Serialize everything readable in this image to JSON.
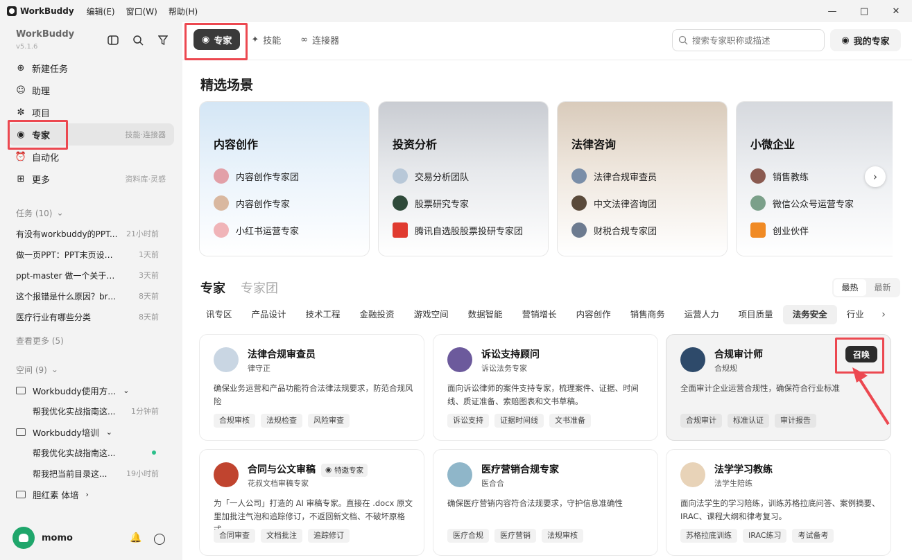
{
  "titlebar": {
    "app": "WorkBuddy",
    "menus": [
      "编辑(E)",
      "窗口(W)",
      "帮助(H)"
    ]
  },
  "sidebar": {
    "brand": "WorkBuddy",
    "version": "v5.1.6",
    "nav": [
      {
        "label": "新建任务",
        "hint": ""
      },
      {
        "label": "助理",
        "hint": ""
      },
      {
        "label": "项目",
        "hint": ""
      },
      {
        "label": "专家",
        "hint": "技能·连接器"
      },
      {
        "label": "自动化",
        "hint": ""
      },
      {
        "label": "更多",
        "hint": "资料库·灵感"
      }
    ],
    "tasks_title": "任务 (10)",
    "tasks": [
      {
        "title": "有没有workbuddy的PPT...",
        "time": "21小时前"
      },
      {
        "title": "做一页PPT：PPT末页设计...",
        "time": "1天前"
      },
      {
        "title": "ppt-master 做一个关于中...",
        "time": "3天前"
      },
      {
        "title": "这个报错是什么原因？bro...",
        "time": "8天前"
      },
      {
        "title": "医疗行业有哪些分类",
        "time": "8天前"
      }
    ],
    "see_more": "查看更多 (5)",
    "spaces_title": "空间 (9)",
    "spaces": [
      {
        "name": "Workbuddy使用方...",
        "children": [
          {
            "title": "帮我优化实战指南这...",
            "time": "1分钟前"
          }
        ]
      },
      {
        "name": "Workbuddy培训",
        "children": [
          {
            "title": "帮我优化实战指南这...",
            "time": ""
          },
          {
            "title": "帮我把当前目录这...",
            "time": "19小时前"
          }
        ]
      },
      {
        "name": "胆红素 体培",
        "children": []
      }
    ],
    "user": "momo"
  },
  "main": {
    "tabs": [
      "专家",
      "技能",
      "连接器"
    ],
    "search_placeholder": "搜索专家职称或描述",
    "my_experts": "我的专家",
    "featured_title": "精选场景",
    "featured": [
      {
        "title": "内容创作",
        "items": [
          "内容创作专家团",
          "内容创作专家",
          "小红书运营专家"
        ]
      },
      {
        "title": "投资分析",
        "items": [
          "交易分析团队",
          "股票研究专家",
          "腾讯自选股股票投研专家团"
        ]
      },
      {
        "title": "法律咨询",
        "items": [
          "法律合规审查员",
          "中文法律咨询团",
          "财税合规专家团"
        ]
      },
      {
        "title": "小微企业",
        "items": [
          "销售教练",
          "微信公众号运营专家",
          "创业伙伴"
        ]
      }
    ],
    "section_tabs": [
      "专家",
      "专家团"
    ],
    "sort": [
      "最热",
      "最新"
    ],
    "categories": [
      "讯专区",
      "产品设计",
      "技术工程",
      "金融投资",
      "游戏空间",
      "数据智能",
      "营销增长",
      "内容创作",
      "销售商务",
      "运营人力",
      "项目质量",
      "法务安全",
      "行业"
    ],
    "active_category": "法务安全",
    "cards": [
      {
        "name": "法律合规审查员",
        "sub": "律守正",
        "badge": "",
        "desc": "确保业务运营和产品功能符合法律法规要求，防范合规风险",
        "tags": [
          "合规审核",
          "法规检查",
          "风险审查"
        ]
      },
      {
        "name": "诉讼支持顾问",
        "sub": "诉讼法务专家",
        "badge": "",
        "desc": "面向诉讼律师的案件支持专家，梳理案件、证据、时间线、质证准备、索赔图表和文书草稿。",
        "tags": [
          "诉讼支持",
          "证据时间线",
          "文书准备"
        ]
      },
      {
        "name": "合规审计师",
        "sub": "合规规",
        "badge": "",
        "desc": "全面审计企业运营合规性，确保符合行业标准",
        "tags": [
          "合规审计",
          "标准认证",
          "审计报告"
        ],
        "action": "召唤"
      },
      {
        "name": "合同与公文审稿",
        "sub": "花叔文档审稿专家",
        "badge": "特邀专家",
        "desc": "为「一人公司」打造的 AI 审稿专家。直接在 .docx 原文里加批注气泡和追踪修订，不返回新文档、不破坏原格式。",
        "tags": [
          "合同审查",
          "文档批注",
          "追踪修订"
        ]
      },
      {
        "name": "医疗营销合规专家",
        "sub": "医合合",
        "badge": "",
        "desc": "确保医疗营销内容符合法规要求，守护信息准确性",
        "tags": [
          "医疗合规",
          "医疗营销",
          "法规审核"
        ]
      },
      {
        "name": "法学学习教练",
        "sub": "法学生陪练",
        "badge": "",
        "desc": "面向法学生的学习陪练，训练苏格拉底问答、案例摘要、IRAC、课程大纲和律考复习。",
        "tags": [
          "苏格拉底训练",
          "IRAC练习",
          "考试备考"
        ]
      }
    ]
  },
  "colors": {
    "accent_red": "#ec4850",
    "dark_button": "#2b2b2b",
    "sidebar_bg": "#f3f3f3"
  }
}
